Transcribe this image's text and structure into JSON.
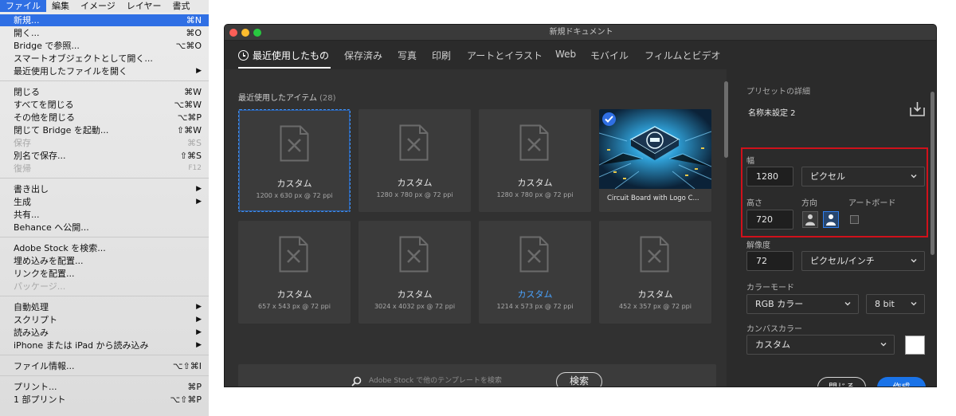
{
  "menubar": {
    "items": [
      "ファイル",
      "編集",
      "イメージ",
      "レイヤー",
      "書式"
    ]
  },
  "file_menu": {
    "items": [
      {
        "label": "新規...",
        "shortcut": "⌘N"
      },
      {
        "label": "開く...",
        "shortcut": "⌘O"
      },
      {
        "label": "Bridge で参照...",
        "shortcut": "⌥⌘O"
      },
      {
        "label": "スマートオブジェクトとして開く...",
        "shortcut": ""
      },
      {
        "label": "最近使用したファイルを開く",
        "shortcut": "▶"
      },
      {
        "label": "閉じる",
        "shortcut": "⌘W"
      },
      {
        "label": "すべてを閉じる",
        "shortcut": "⌥⌘W"
      },
      {
        "label": "その他を閉じる",
        "shortcut": "⌥⌘P"
      },
      {
        "label": "閉じて Bridge を起動...",
        "shortcut": "⇧⌘W"
      },
      {
        "label": "保存",
        "shortcut": "⌘S"
      },
      {
        "label": "別名で保存...",
        "shortcut": "⇧⌘S"
      },
      {
        "label": "復帰",
        "shortcut": "F12"
      },
      {
        "label": "書き出し",
        "shortcut": "▶"
      },
      {
        "label": "生成",
        "shortcut": "▶"
      },
      {
        "label": "共有...",
        "shortcut": ""
      },
      {
        "label": "Behance へ公開...",
        "shortcut": ""
      },
      {
        "label": "Adobe Stock を検索...",
        "shortcut": ""
      },
      {
        "label": "埋め込みを配置...",
        "shortcut": ""
      },
      {
        "label": "リンクを配置...",
        "shortcut": ""
      },
      {
        "label": "パッケージ...",
        "shortcut": ""
      },
      {
        "label": "自動処理",
        "shortcut": "▶"
      },
      {
        "label": "スクリプト",
        "shortcut": "▶"
      },
      {
        "label": "読み込み",
        "shortcut": "▶"
      },
      {
        "label": "iPhone または iPad から読み込み",
        "shortcut": "▶"
      },
      {
        "label": "ファイル情報...",
        "shortcut": "⌥⇧⌘I"
      },
      {
        "label": "プリント...",
        "shortcut": "⌘P"
      },
      {
        "label": "1 部プリント",
        "shortcut": "⌥⇧⌘P"
      }
    ]
  },
  "dialog": {
    "title": "新規ドキュメント",
    "tabs": [
      "最近使用したもの",
      "保存済み",
      "写真",
      "印刷",
      "アートとイラスト",
      "Web",
      "モバイル",
      "フィルムとビデオ"
    ],
    "recent_label": "最近使用したアイテム",
    "recent_count": "(28)",
    "cards": [
      {
        "name": "カスタム",
        "size": "1200 x 630 px @ 72 ppi"
      },
      {
        "name": "カスタム",
        "size": "1280 x 780 px @ 72 ppi"
      },
      {
        "name": "カスタム",
        "size": "1280 x 780 px @ 72 ppi"
      },
      {
        "name": "Circuit Board with Logo C..."
      },
      {
        "name": "カスタム",
        "size": "657 x 543 px @ 72 ppi"
      },
      {
        "name": "カスタム",
        "size": "3024 x 4032 px @ 72 ppi"
      },
      {
        "name": "カスタム",
        "size": "1214 x 573 px @ 72 ppi"
      },
      {
        "name": "カスタム",
        "size": "452 x 357 px @ 72 ppi"
      }
    ],
    "stock_placeholder": "Adobe Stock で他のテンプレートを検索",
    "stock_button": "検索",
    "details": {
      "heading": "プリセットの詳細",
      "preset_name": "名称未設定 2",
      "width_label": "幅",
      "width_value": "1280",
      "width_unit": "ピクセル",
      "height_label": "高さ",
      "height_value": "720",
      "orientation_label": "方向",
      "artboard_label": "アートボード",
      "resolution_label": "解像度",
      "resolution_value": "72",
      "resolution_unit": "ピクセル/インチ",
      "color_mode_label": "カラーモード",
      "color_mode": "RGB カラー",
      "bit_depth": "8 bit",
      "canvas_color_label": "カンバスカラー",
      "canvas_color": "カスタム"
    },
    "close_button": "閉じる",
    "create_button": "作成"
  },
  "colors": {
    "accent": "#1a73e8",
    "highlight": "#d0111b",
    "menu_selection": "#2f6fe4"
  }
}
